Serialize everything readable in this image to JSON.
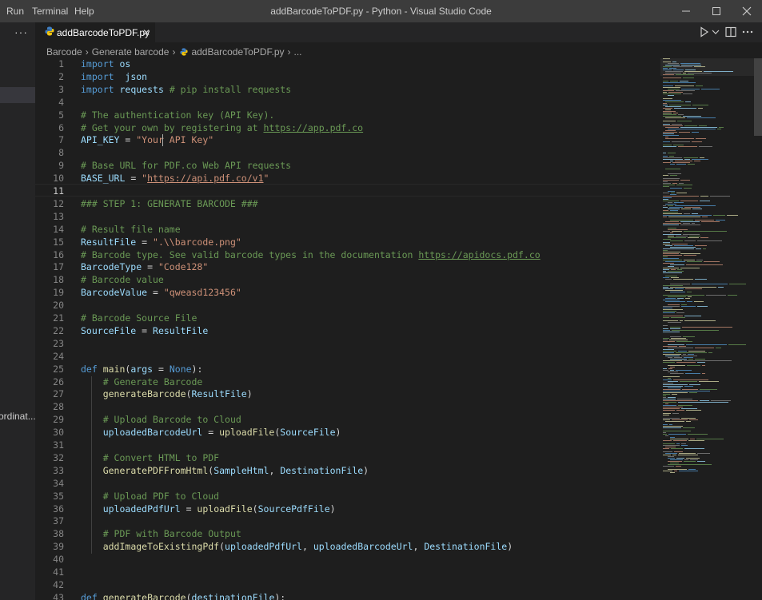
{
  "menu": {
    "run": "Run",
    "terminal": "Terminal",
    "help": "Help"
  },
  "window_title": "addBarcodeToPDF.py - Python - Visual Studio Code",
  "sidebar": {
    "more": "···",
    "truncated_item": "ordinat..."
  },
  "tab": {
    "label": "addBarcodeToPDF.py",
    "close": "✕"
  },
  "breadcrumb": {
    "items": [
      "Barcode",
      "Generate barcode",
      "addBarcodeToPDF.py",
      "..."
    ]
  },
  "editor": {
    "current_line": 11,
    "lines": [
      {
        "n": "1",
        "tokens": [
          [
            "kw",
            "import"
          ],
          [
            "op",
            " "
          ],
          [
            "var",
            "os"
          ]
        ]
      },
      {
        "n": "2",
        "tokens": [
          [
            "kw",
            "import"
          ],
          [
            "op",
            "  "
          ],
          [
            "var",
            "json"
          ]
        ]
      },
      {
        "n": "3",
        "tokens": [
          [
            "kw",
            "import"
          ],
          [
            "op",
            " "
          ],
          [
            "var",
            "requests"
          ],
          [
            "op",
            " "
          ],
          [
            "cm",
            "# pip install requests"
          ]
        ]
      },
      {
        "n": "4",
        "tokens": []
      },
      {
        "n": "5",
        "tokens": [
          [
            "cm",
            "# The authentication key (API Key)."
          ]
        ]
      },
      {
        "n": "6",
        "tokens": [
          [
            "cm",
            "# Get your own by registering at "
          ],
          [
            "cmurl",
            "https://app.pdf.co"
          ]
        ]
      },
      {
        "n": "7",
        "tokens": [
          [
            "var",
            "API_KEY"
          ],
          [
            "op",
            " = "
          ],
          [
            "str",
            "\"Your API Key\""
          ]
        ]
      },
      {
        "n": "8",
        "tokens": []
      },
      {
        "n": "9",
        "tokens": [
          [
            "cm",
            "# Base URL for PDF.co Web API requests"
          ]
        ]
      },
      {
        "n": "10",
        "tokens": [
          [
            "var",
            "BASE_URL"
          ],
          [
            "op",
            " = "
          ],
          [
            "str",
            "\""
          ],
          [
            "strurl",
            "https://api.pdf.co/v1"
          ],
          [
            "str",
            "\""
          ]
        ]
      },
      {
        "n": "11",
        "tokens": []
      },
      {
        "n": "12",
        "tokens": [
          [
            "cm",
            "### STEP 1: GENERATE BARCODE ###"
          ]
        ]
      },
      {
        "n": "13",
        "tokens": []
      },
      {
        "n": "14",
        "tokens": [
          [
            "cm",
            "# Result file name"
          ]
        ]
      },
      {
        "n": "15",
        "tokens": [
          [
            "var",
            "ResultFile"
          ],
          [
            "op",
            " = "
          ],
          [
            "str",
            "\".\\\\barcode.png\""
          ]
        ]
      },
      {
        "n": "16",
        "tokens": [
          [
            "cm",
            "# Barcode type. See valid barcode types in the documentation "
          ],
          [
            "cmurl",
            "https://apidocs.pdf.co"
          ]
        ]
      },
      {
        "n": "17",
        "tokens": [
          [
            "var",
            "BarcodeType"
          ],
          [
            "op",
            " = "
          ],
          [
            "str",
            "\"Code128\""
          ]
        ]
      },
      {
        "n": "18",
        "tokens": [
          [
            "cm",
            "# Barcode value"
          ]
        ]
      },
      {
        "n": "19",
        "tokens": [
          [
            "var",
            "BarcodeValue"
          ],
          [
            "op",
            " = "
          ],
          [
            "str",
            "\"qweasd123456\""
          ]
        ]
      },
      {
        "n": "20",
        "tokens": []
      },
      {
        "n": "21",
        "tokens": [
          [
            "cm",
            "# Barcode Source File"
          ]
        ]
      },
      {
        "n": "22",
        "tokens": [
          [
            "var",
            "SourceFile"
          ],
          [
            "op",
            " = "
          ],
          [
            "var",
            "ResultFile"
          ]
        ]
      },
      {
        "n": "23",
        "tokens": []
      },
      {
        "n": "24",
        "tokens": []
      },
      {
        "n": "25",
        "tokens": [
          [
            "kw",
            "def"
          ],
          [
            "op",
            " "
          ],
          [
            "fn",
            "main"
          ],
          [
            "op",
            "("
          ],
          [
            "var",
            "args"
          ],
          [
            "op",
            " = "
          ],
          [
            "kw",
            "None"
          ],
          [
            "op",
            "):"
          ]
        ]
      },
      {
        "n": "26",
        "tokens": [
          [
            "op",
            "    "
          ],
          [
            "cm",
            "# Generate Barcode"
          ]
        ]
      },
      {
        "n": "27",
        "tokens": [
          [
            "op",
            "    "
          ],
          [
            "fn",
            "generateBarcode"
          ],
          [
            "op",
            "("
          ],
          [
            "var",
            "ResultFile"
          ],
          [
            "op",
            ")"
          ]
        ]
      },
      {
        "n": "28",
        "tokens": []
      },
      {
        "n": "29",
        "tokens": [
          [
            "op",
            "    "
          ],
          [
            "cm",
            "# Upload Barcode to Cloud"
          ]
        ]
      },
      {
        "n": "30",
        "tokens": [
          [
            "op",
            "    "
          ],
          [
            "var",
            "uploadedBarcodeUrl"
          ],
          [
            "op",
            " = "
          ],
          [
            "fn",
            "uploadFile"
          ],
          [
            "op",
            "("
          ],
          [
            "var",
            "SourceFile"
          ],
          [
            "op",
            ")"
          ]
        ]
      },
      {
        "n": "31",
        "tokens": []
      },
      {
        "n": "32",
        "tokens": [
          [
            "op",
            "    "
          ],
          [
            "cm",
            "# Convert HTML to PDF"
          ]
        ]
      },
      {
        "n": "33",
        "tokens": [
          [
            "op",
            "    "
          ],
          [
            "fn",
            "GeneratePDFFromHtml"
          ],
          [
            "op",
            "("
          ],
          [
            "var",
            "SampleHtml"
          ],
          [
            "op",
            ", "
          ],
          [
            "var",
            "DestinationFile"
          ],
          [
            "op",
            ")"
          ]
        ]
      },
      {
        "n": "34",
        "tokens": []
      },
      {
        "n": "35",
        "tokens": [
          [
            "op",
            "    "
          ],
          [
            "cm",
            "# Upload PDF to Cloud"
          ]
        ]
      },
      {
        "n": "36",
        "tokens": [
          [
            "op",
            "    "
          ],
          [
            "var",
            "uploadedPdfUrl"
          ],
          [
            "op",
            " = "
          ],
          [
            "fn",
            "uploadFile"
          ],
          [
            "op",
            "("
          ],
          [
            "var",
            "SourcePdfFile"
          ],
          [
            "op",
            ")"
          ]
        ]
      },
      {
        "n": "37",
        "tokens": []
      },
      {
        "n": "38",
        "tokens": [
          [
            "op",
            "    "
          ],
          [
            "cm",
            "# PDF with Barcode Output"
          ]
        ]
      },
      {
        "n": "39",
        "tokens": [
          [
            "op",
            "    "
          ],
          [
            "fn",
            "addImageToExistingPdf"
          ],
          [
            "op",
            "("
          ],
          [
            "var",
            "uploadedPdfUrl"
          ],
          [
            "op",
            ", "
          ],
          [
            "var",
            "uploadedBarcodeUrl"
          ],
          [
            "op",
            ", "
          ],
          [
            "var",
            "DestinationFile"
          ],
          [
            "op",
            ")"
          ]
        ]
      },
      {
        "n": "40",
        "tokens": []
      },
      {
        "n": "41",
        "tokens": []
      },
      {
        "n": "42",
        "tokens": []
      },
      {
        "n": "43",
        "tokens": [
          [
            "kw",
            "def"
          ],
          [
            "op",
            " "
          ],
          [
            "fn",
            "generateBarcode"
          ],
          [
            "op",
            "("
          ],
          [
            "var",
            "destinationFile"
          ],
          [
            "op",
            "):"
          ]
        ]
      }
    ]
  },
  "colors": {
    "keyword": "#569cd6",
    "function": "#dcdcaa",
    "variable": "#9cdcfe",
    "string": "#ce9178",
    "comment": "#6a9955",
    "editor_bg": "#1e1e1e",
    "titlebar_bg": "#3c3c3c",
    "sidebar_bg": "#252526"
  },
  "icons": {
    "tab_file": "python-file-icon",
    "run": "run-play-icon",
    "split": "split-editor-icon",
    "more": "more-actions-icon",
    "minimize": "minimize-icon",
    "maximize": "maximize-icon",
    "close": "close-window-icon"
  }
}
